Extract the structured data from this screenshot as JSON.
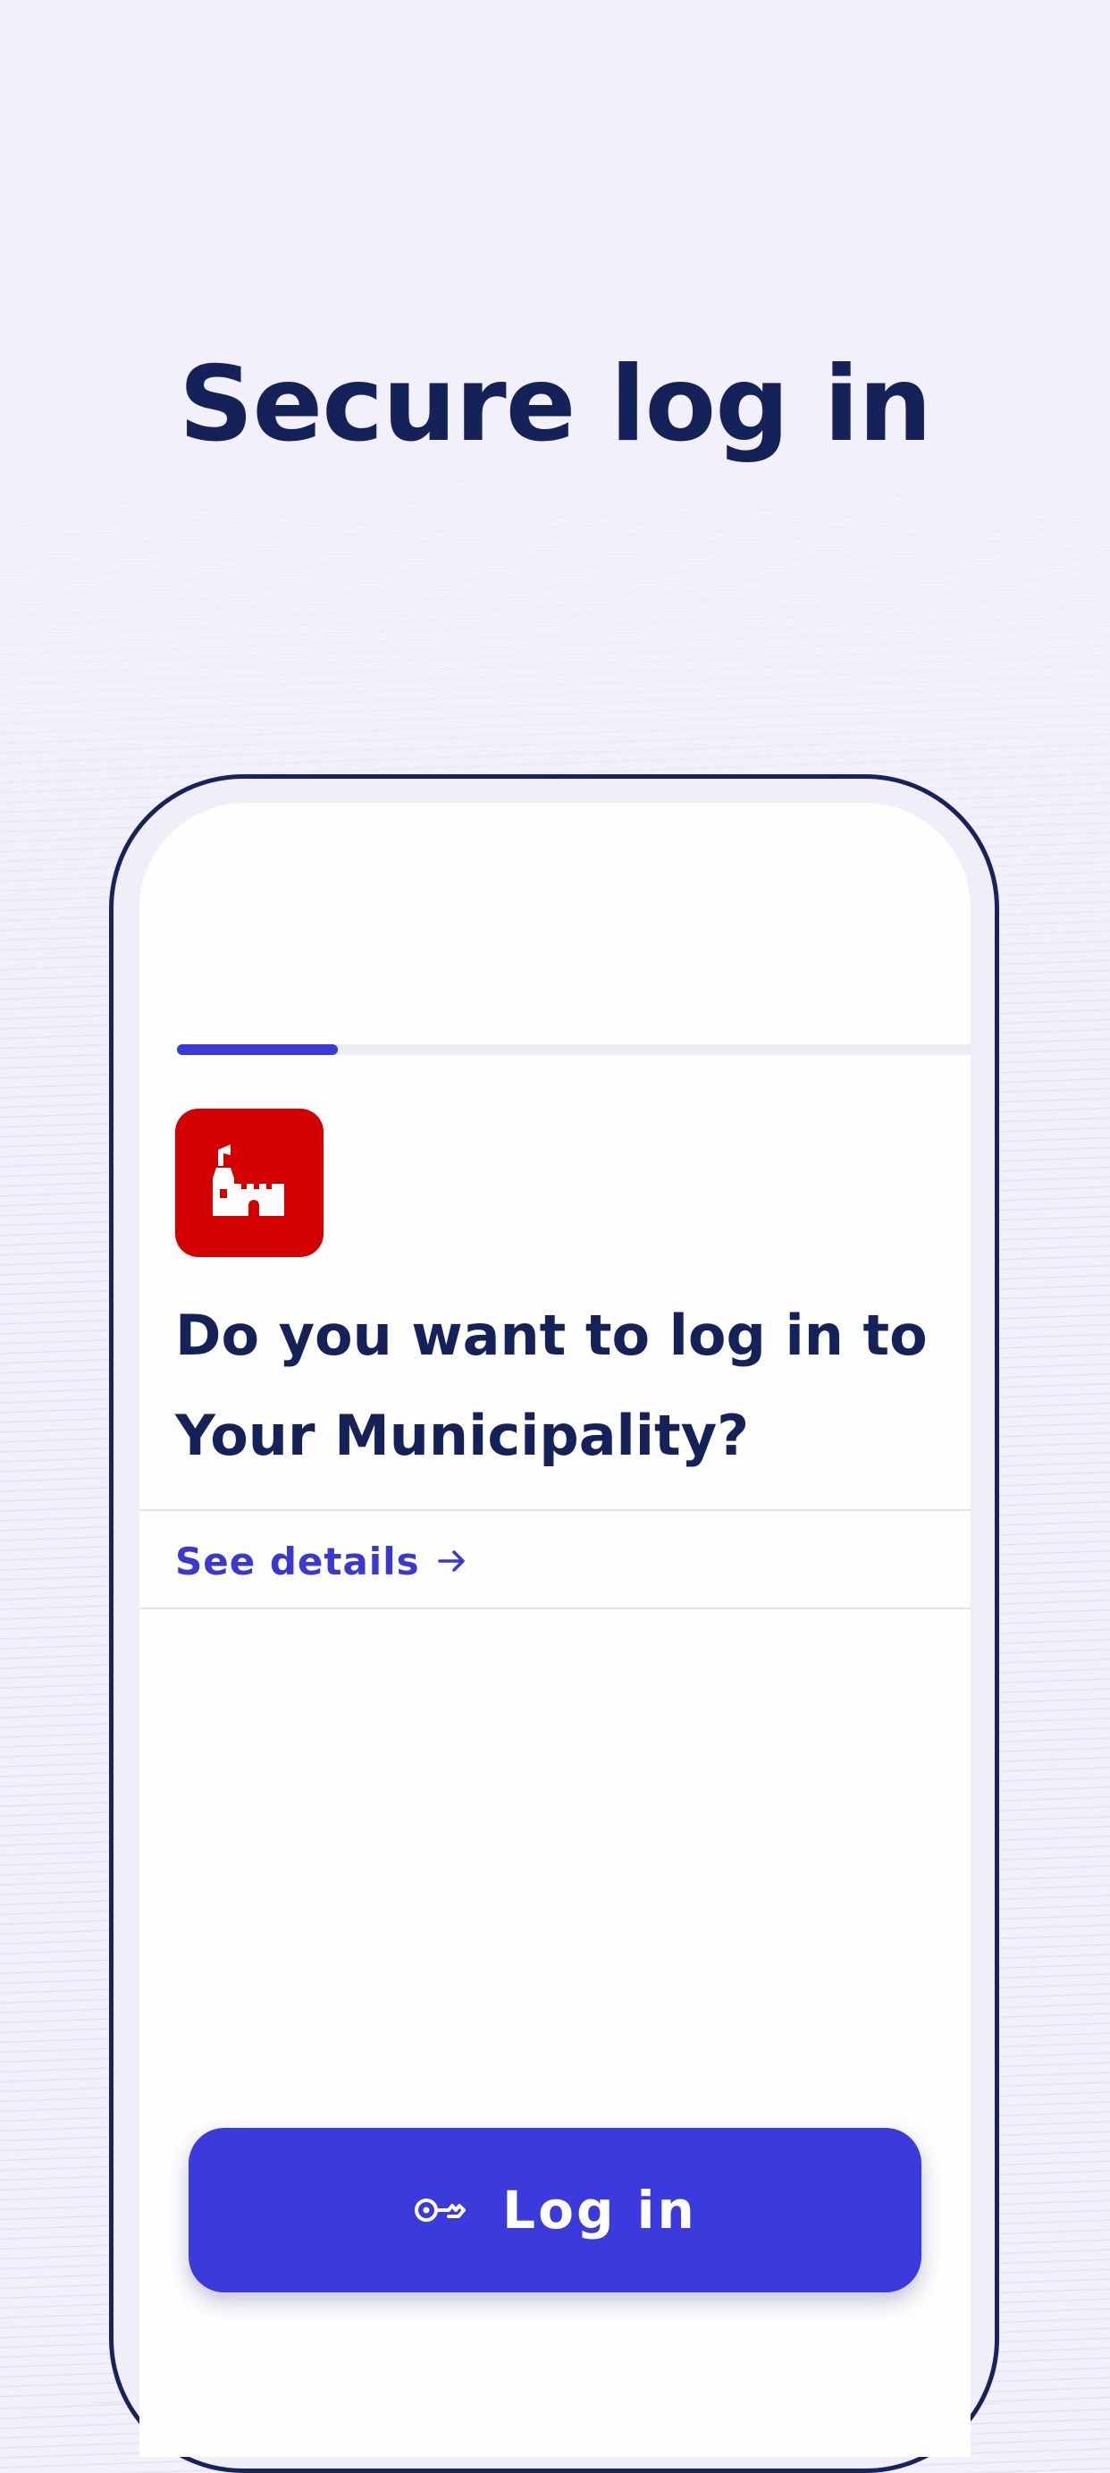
{
  "headline": "Secure log in",
  "colors": {
    "background": "#f2f1fb",
    "primary_text": "#15225a",
    "accent": "#3a3add",
    "org_logo": "#d40000"
  },
  "login_request": {
    "progress_fraction": 0.2,
    "org_logo_icon": "castle-icon",
    "question": "Do you want to log in to Your Municipality?",
    "details_link": "See details",
    "details_icon": "arrow-right-icon"
  },
  "login_button": {
    "label": "Log in",
    "icon": "key-icon"
  }
}
